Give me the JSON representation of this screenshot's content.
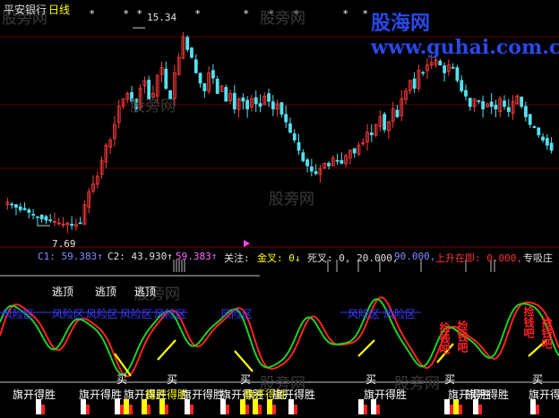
{
  "title": {
    "stock": "平安银行",
    "period": "日线"
  },
  "watermark": {
    "site": "股海网 www.guhai.com.cn",
    "faint": [
      "股旁网",
      "股旁网",
      "股旁网",
      "股旁网",
      "股旁网",
      "股旁网",
      "股旁网"
    ]
  },
  "price_labels": {
    "high": "15.34",
    "low": "7.69"
  },
  "indicator_bar": {
    "c1": "C1: 59.383↑",
    "c2": "C2: 43.930↑",
    "c2b": "59.383↑",
    "focus": "关注:",
    "gold": "金叉: 0↓",
    "dead": "死叉: 0, 20.000,",
    "ninety": "90.000,",
    "rise": "上升在即: 0.000,",
    "absorb": "专吸庄"
  },
  "escape_labels": [
    "逃顶",
    "逃顶",
    "逃顶"
  ],
  "risk_label": "风险区",
  "buy_label": "买",
  "win_label": "旗开得胜",
  "dip_label": "捡钱吧",
  "colors": {
    "up": "#ff3b3b",
    "down": "#54e1f0",
    "green": "#1fd11f",
    "yellow": "#ffff00",
    "blue": "#3c3cff",
    "magenta": "#ff44ff",
    "red": "#ff2222",
    "white": "#ffffff"
  },
  "chart_data": [
    {
      "type": "candlestick",
      "title": "平安银行 日线",
      "ylim": [
        7.0,
        16.0
      ],
      "price_high": 15.34,
      "price_low": 7.69,
      "close": [
        8.6,
        8.5,
        8.4,
        8.3,
        8.3,
        8.2,
        8.1,
        8.0,
        7.95,
        7.9,
        7.9,
        7.85,
        7.8,
        7.75,
        7.8,
        7.7,
        7.75,
        7.8,
        8.5,
        9.0,
        9.3,
        9.6,
        10.2,
        10.8,
        11.0,
        11.6,
        12.3,
        12.6,
        12.8,
        12.5,
        12.2,
        13.0,
        13.3,
        12.6,
        12.8,
        13.5,
        13.8,
        13.0,
        12.6,
        13.6,
        14.2,
        15.0,
        14.5,
        14.2,
        13.6,
        13.2,
        12.9,
        13.6,
        13.4,
        12.8,
        13.1,
        12.5,
        12.8,
        12.2,
        12.6,
        12.5,
        12.2,
        12.6,
        12.4,
        12.3,
        12.7,
        12.5,
        12.2,
        12.4,
        12.0,
        11.7,
        11.3,
        11.0,
        10.6,
        10.2,
        10.0,
        9.8,
        9.7,
        9.9,
        10.1,
        10.0,
        10.3,
        10.2,
        10.1,
        10.4,
        10.6,
        10.5,
        10.8,
        10.9,
        11.3,
        11.2,
        11.6,
        11.9,
        11.4,
        11.7,
        12.2,
        11.9,
        12.6,
        12.9,
        13.3,
        13.0,
        13.7,
        13.6,
        13.9,
        14.0,
        14.1,
        13.9,
        13.6,
        13.9,
        13.8,
        13.3,
        12.9,
        12.7,
        12.3,
        12.6,
        12.5,
        12.2,
        12.4,
        12.3,
        12.2,
        12.6,
        12.3,
        12.1,
        12.5,
        12.7,
        12.3,
        11.9,
        11.6,
        11.5,
        11.2,
        11.0,
        10.8,
        10.6
      ]
    },
    {
      "type": "line",
      "series": [
        {
          "name": "C1",
          "value": 59.383,
          "color": "#ff3b3b"
        },
        {
          "name": "C2",
          "value": 43.93,
          "color": "#1fd11f"
        }
      ],
      "levels": [
        0,
        20,
        90
      ],
      "rise": 0.0
    }
  ]
}
